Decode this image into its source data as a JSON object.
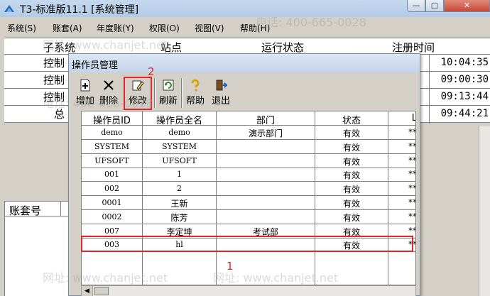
{
  "window": {
    "title": "T3-标准版11.1 [系统管理]"
  },
  "window_controls": {
    "minimize": "—",
    "maximize": "▢",
    "close": "✕"
  },
  "menu": {
    "items": [
      {
        "label": "系统(S)"
      },
      {
        "label": "账套(A)"
      },
      {
        "label": "年度账(Y)"
      },
      {
        "label": "权限(O)"
      },
      {
        "label": "视图(V)"
      },
      {
        "label": "帮助(H)"
      }
    ]
  },
  "main_table": {
    "headers": {
      "subsystem": "子系统",
      "site": "站点",
      "status": "运行状态",
      "reg_time": "注册时间"
    },
    "rows": [
      {
        "subsystem": "控制",
        "time": "10:04:35"
      },
      {
        "subsystem": "控制",
        "time": "09:00:30"
      },
      {
        "subsystem": "控制",
        "time": "09:13:44"
      },
      {
        "subsystem": "总",
        "time": "09:44:21"
      }
    ]
  },
  "account_panel": {
    "header": "账套号"
  },
  "dialog": {
    "title": "操作员管理",
    "toolbar": {
      "add": "增加",
      "delete": "删除",
      "modify": "修改",
      "refresh": "刷新",
      "help": "帮助",
      "exit": "退出"
    },
    "icons": {
      "add": "add-icon",
      "delete": "delete-icon",
      "modify": "edit-icon",
      "refresh": "refresh-icon",
      "help": "help-icon",
      "exit": "exit-icon"
    },
    "callouts": {
      "modify_step": "2",
      "row_step": "1"
    },
    "columns": {
      "id": "操作员ID",
      "name": "操作员全名",
      "dept": "部门",
      "status": "状态",
      "extra": "L"
    },
    "rows": [
      {
        "id": "demo",
        "name": "demo",
        "dept": "演示部门",
        "status": "有效",
        "extra": "**"
      },
      {
        "id": "SYSTEM",
        "name": "SYSTEM",
        "dept": "",
        "status": "有效",
        "extra": "**"
      },
      {
        "id": "UFSOFT",
        "name": "UFSOFT",
        "dept": "",
        "status": "有效",
        "extra": "**"
      },
      {
        "id": "001",
        "name": "1",
        "dept": "",
        "status": "有效",
        "extra": "**"
      },
      {
        "id": "002",
        "name": "2",
        "dept": "",
        "status": "有效",
        "extra": "**"
      },
      {
        "id": "0001",
        "name": "王新",
        "dept": "",
        "status": "有效",
        "extra": "**"
      },
      {
        "id": "0002",
        "name": "陈芳",
        "dept": "",
        "status": "有效",
        "extra": "**"
      },
      {
        "id": "007",
        "name": "李定坤",
        "dept": "考试部",
        "status": "有效",
        "extra": "**"
      },
      {
        "id": "003",
        "name": "hl",
        "dept": "",
        "status": "有效",
        "extra": "**"
      }
    ],
    "selected_row_index": 8
  },
  "watermarks": {
    "phone": "电话: 400-665-0028",
    "site": "网址: www.chanjet.net"
  },
  "colors": {
    "highlight": "#e0252b",
    "title_bg": "#c5d8ee"
  }
}
